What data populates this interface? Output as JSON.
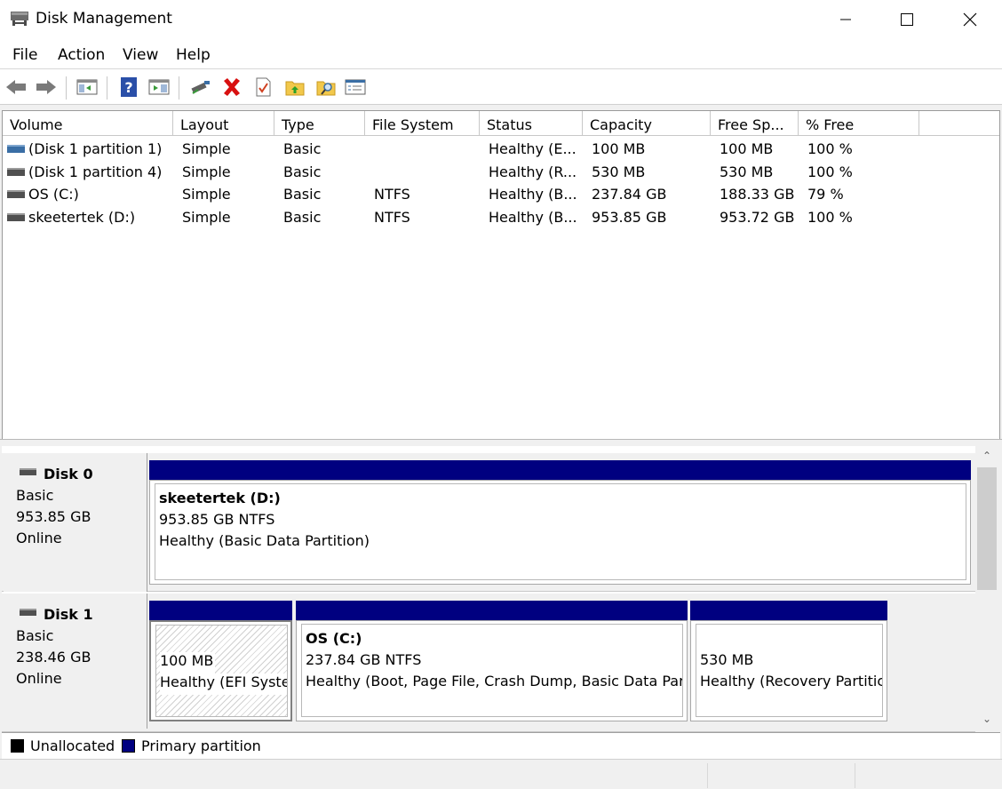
{
  "window": {
    "title": "Disk Management"
  },
  "menu": {
    "items": [
      "File",
      "Action",
      "View",
      "Help"
    ]
  },
  "toolbar": {
    "icons": [
      "back-arrow-icon",
      "forward-arrow-icon",
      "console-tree-icon",
      "help-icon",
      "details-pane-icon",
      "connect-disk-icon",
      "delete-icon",
      "properties-icon",
      "folder-up-icon",
      "search-folder-icon",
      "options-icon"
    ]
  },
  "columns": [
    "Volume",
    "Layout",
    "Type",
    "File System",
    "Status",
    "Capacity",
    "Free Sp...",
    "% Free"
  ],
  "volumes": [
    {
      "volume": "(Disk 1 partition 1)",
      "layout": "Simple",
      "type": "Basic",
      "fs": "",
      "status": "Healthy (E...",
      "capacity": "100 MB",
      "free": "100 MB",
      "pct": "100 %",
      "icon_color": "#3a6ea5"
    },
    {
      "volume": "(Disk 1 partition 4)",
      "layout": "Simple",
      "type": "Basic",
      "fs": "",
      "status": "Healthy (R...",
      "capacity": "530 MB",
      "free": "530 MB",
      "pct": "100 %",
      "icon_color": "#505050"
    },
    {
      "volume": "OS (C:)",
      "layout": "Simple",
      "type": "Basic",
      "fs": "NTFS",
      "status": "Healthy (B...",
      "capacity": "237.84 GB",
      "free": "188.33 GB",
      "pct": "79 %",
      "icon_color": "#505050"
    },
    {
      "volume": "skeetertek (D:)",
      "layout": "Simple",
      "type": "Basic",
      "fs": "NTFS",
      "status": "Healthy (B...",
      "capacity": "953.85 GB",
      "free": "953.72 GB",
      "pct": "100 %",
      "icon_color": "#505050"
    }
  ],
  "disks": [
    {
      "name": "Disk 0",
      "type": "Basic",
      "size": "953.85 GB",
      "state": "Online",
      "partitions": [
        {
          "title": "skeetertek  (D:)",
          "line1": "953.85 GB NTFS",
          "line2": "Healthy (Basic Data Partition)"
        }
      ]
    },
    {
      "name": "Disk 1",
      "type": "Basic",
      "size": "238.46 GB",
      "state": "Online",
      "partitions": [
        {
          "title": "",
          "line1": "100 MB",
          "line2": "Healthy (EFI Syste"
        },
        {
          "title": "OS  (C:)",
          "line1": "237.84 GB NTFS",
          "line2": "Healthy (Boot, Page File, Crash Dump, Basic Data Par"
        },
        {
          "title": "",
          "line1": "530 MB",
          "line2": "Healthy (Recovery Partitic"
        }
      ]
    }
  ],
  "legend": {
    "unallocated": "Unallocated",
    "primary": "Primary partition",
    "unallocated_color": "#000000",
    "primary_color": "#000080"
  },
  "colors": {
    "partition_bar": "#000080",
    "selection_hatch": "#d0d0d0"
  }
}
